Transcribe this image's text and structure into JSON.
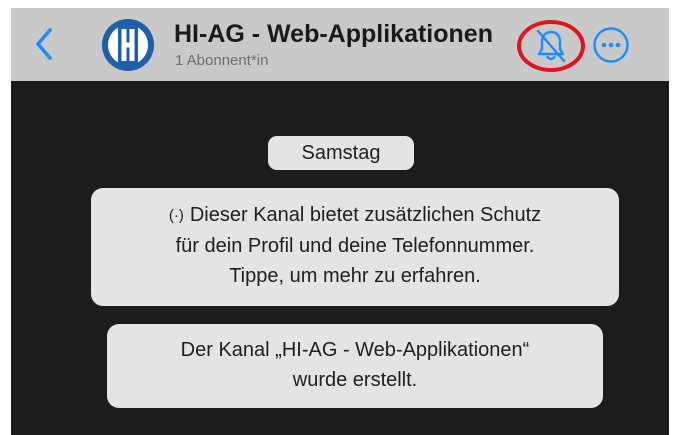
{
  "header": {
    "back_icon": "chevron-left-icon",
    "avatar_icon": "channel-logo",
    "title": "HI-AG - Web-Applikationen",
    "subtitle": "1 Abonnent*in",
    "mute_icon": "bell-slash-icon",
    "more_icon": "ellipsis-circle-icon",
    "colors": {
      "accent": "#1e8bff",
      "highlight_ring": "#e0141e",
      "header_bg": "#c9c9c9"
    }
  },
  "chat": {
    "background": "#1b1c1e",
    "date_label": "Samstag",
    "info_notice": {
      "icon": "broadcast-icon",
      "icon_glyph": "(·)",
      "line1": "Dieser Kanal bietet zusätzlichen Schutz",
      "line2": "für dein Profil und deine Telefonnummer.",
      "line3": "Tippe, um mehr zu erfahren."
    },
    "created_notice": {
      "line1": "Der Kanal „HI-AG - Web-Applikationen“",
      "line2": "wurde erstellt."
    }
  }
}
